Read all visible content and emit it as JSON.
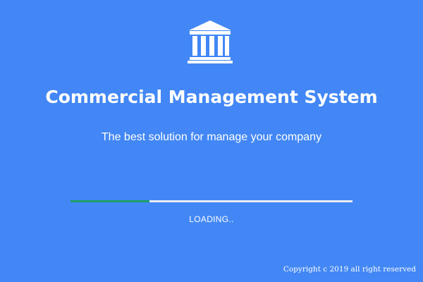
{
  "app": {
    "title": "Commercial Management System",
    "subtitle": "The best solution for manage your company"
  },
  "logo": {
    "icon": "bank-building-icon"
  },
  "loading": {
    "label": "LOADING..",
    "progress": 0.28
  },
  "footer": {
    "copyright": "Copyright c 2019 all right reserved"
  },
  "colors": {
    "background": "#4287f5",
    "text": "#ffffff",
    "progress_fill": "#1e9e6a",
    "progress_track": "#e8ecf4"
  }
}
